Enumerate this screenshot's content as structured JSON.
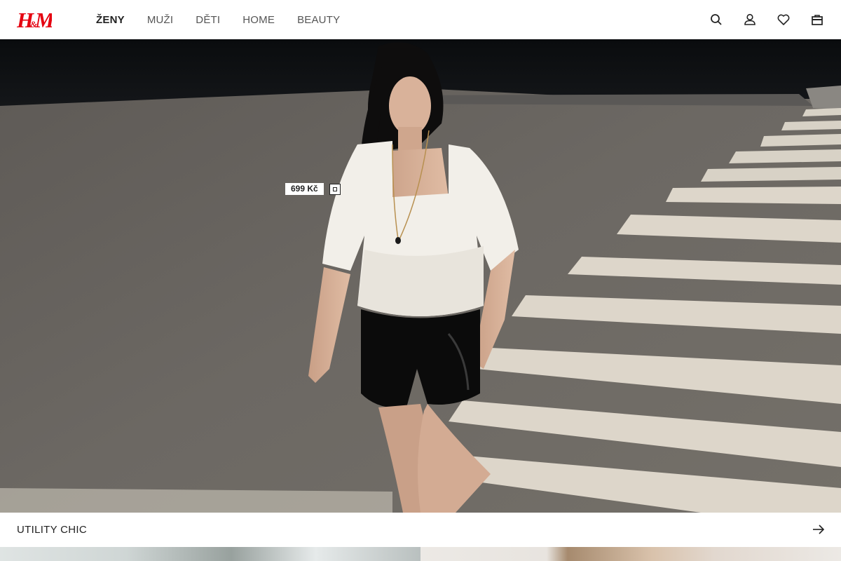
{
  "brand": {
    "logo_text": "H&M",
    "color": "#e50010"
  },
  "nav": {
    "items": [
      {
        "label": "ŽENY",
        "active": true
      },
      {
        "label": "MUŽI",
        "active": false
      },
      {
        "label": "DĚTI",
        "active": false
      },
      {
        "label": "HOME",
        "active": false
      },
      {
        "label": "BEAUTY",
        "active": false
      }
    ]
  },
  "header_icons": [
    "search-icon",
    "account-icon",
    "heart-icon",
    "bag-icon"
  ],
  "hero": {
    "price_tag": {
      "price": "699 Kč",
      "icon": "product-tag-icon"
    }
  },
  "campaign": {
    "title": "UTILITY CHIC",
    "arrow_icon": "arrow-right-icon"
  }
}
